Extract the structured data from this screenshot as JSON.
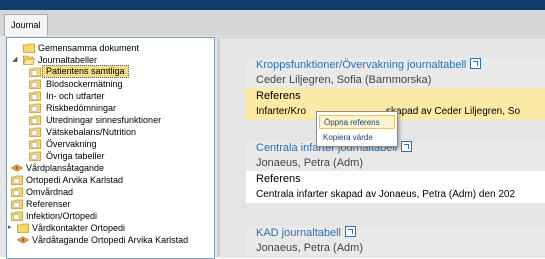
{
  "window": {
    "tab_label": "Journal"
  },
  "sidebar": {
    "items": [
      {
        "label": "Gemensamma dokument",
        "icon": "folder-icon"
      },
      {
        "label": "Journaltabeller",
        "icon": "folder-open-icon"
      },
      {
        "label": "Patientens samtliga",
        "icon": "document-folder-icon"
      },
      {
        "label": "Blodsockermätning",
        "icon": "document-folder-icon"
      },
      {
        "label": "In- och utfarter",
        "icon": "document-folder-icon"
      },
      {
        "label": "Riskbedömningar",
        "icon": "document-folder-icon"
      },
      {
        "label": "Utredningar sinnesfunktioner",
        "icon": "document-folder-icon"
      },
      {
        "label": "Vätskebalans/Nutrition",
        "icon": "document-folder-icon"
      },
      {
        "label": "Övervakning",
        "icon": "document-folder-icon"
      },
      {
        "label": "Övriga tabeller",
        "icon": "document-folder-icon"
      },
      {
        "label": "Vårdplansåtagande",
        "icon": "care-plan-icon"
      },
      {
        "label": "Ortopedi Arvika Karlstad",
        "icon": "document-folder-icon"
      },
      {
        "label": "Omvårdnad",
        "icon": "document-folder-icon"
      },
      {
        "label": "Referenser",
        "icon": "document-folder-icon"
      },
      {
        "label": "Infektion/Ortopedi",
        "icon": "document-folder-icon"
      },
      {
        "label": "Vårdkontakter Ortopedi",
        "icon": "folder-icon"
      },
      {
        "label": "Vårdåtagande Ortopedi Arvika Karlstad",
        "icon": "care-plan-icon"
      }
    ],
    "selected": "Patientens samtliga"
  },
  "cards": [
    {
      "title": "Kroppsfunktioner/Övervakning journaltabell",
      "author": "Ceder Liljegren, Sofia (Barnmorska)",
      "ref_label": "Referens",
      "ref_text_left": "Infarter/Kro",
      "ref_text_right": "skapad av Ceder Liljegren, So"
    },
    {
      "title": "Centrala infarter journaltabell",
      "author": "Jonaeus, Petra (Adm)",
      "ref_label": "Referens",
      "ref_text": "Centrala infarter skapad av Jonaeus, Petra (Adm) den 202"
    },
    {
      "title": "KAD journaltabell",
      "author": "Jonaeus, Petra (Adm)"
    }
  ],
  "context_menu": {
    "items": [
      "Öppna referens",
      "Kopiera värde"
    ]
  },
  "colors": {
    "accent": "#2a72b5",
    "highlight": "#fbe9a6",
    "selection": "#f3dd83",
    "titlebar": "#0e3d6b"
  }
}
